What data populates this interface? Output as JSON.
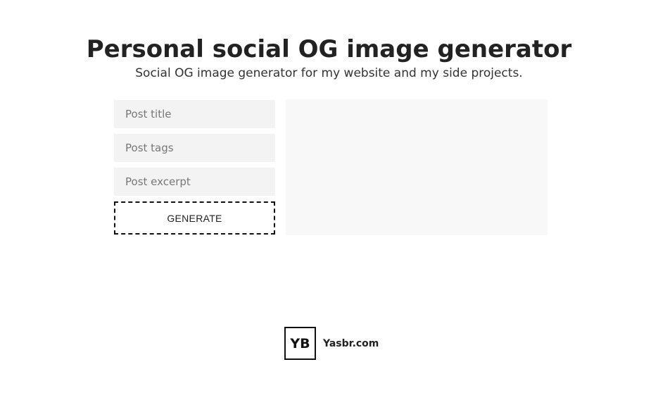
{
  "header": {
    "title": "Personal social OG image generator",
    "subtitle": "Social OG image generator for my website and my side projects."
  },
  "form": {
    "post_title_placeholder": "Post title",
    "post_tags_placeholder": "Post tags",
    "post_excerpt_placeholder": "Post excerpt",
    "post_title_value": "",
    "post_tags_value": "",
    "post_excerpt_value": "",
    "generate_label": "GENERATE"
  },
  "footer": {
    "logo_text": "YB",
    "site_label": "Yasbr.com"
  },
  "colors": {
    "input_background": "#f3f3f3",
    "preview_background": "#f8f8f8",
    "text": "#222222"
  }
}
